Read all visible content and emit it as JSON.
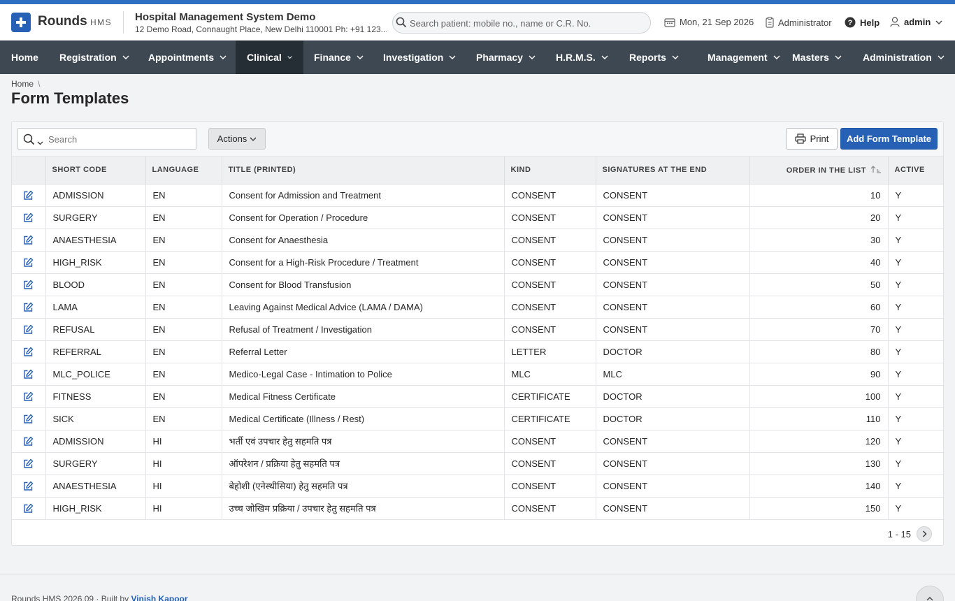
{
  "app": {
    "name": "Rounds",
    "suffix": "HMS",
    "logo_icon": "plus-icon"
  },
  "org": {
    "name": "Hospital Management System Demo",
    "address": "12 Demo Road, Connaught Place, New Delhi 110001 Ph: +91 123..."
  },
  "header": {
    "search_placeholder": "Search patient: mobile no., name or C.R. No.",
    "date": "Mon, 21 Sep 2026",
    "role": "Administrator",
    "help": "Help",
    "user": "admin"
  },
  "nav": {
    "items": [
      "Home",
      "Registration",
      "Appointments",
      "Clinical",
      "Finance",
      "Investigation",
      "Pharmacy",
      "H.R.M.S.",
      "Reports",
      "Management",
      "Masters",
      "Administration"
    ],
    "active": "Clinical"
  },
  "breadcrumb": {
    "home": "Home",
    "separator": "\\"
  },
  "page": {
    "title": "Form Templates"
  },
  "toolbar": {
    "search_placeholder": "Search",
    "actions_label": "Actions",
    "print_label": "Print",
    "add_label": "Add Form Template"
  },
  "table": {
    "columns": [
      "",
      "SHORT CODE",
      "LANGUAGE",
      "TITLE (PRINTED)",
      "KIND",
      "SIGNATURES AT THE END",
      "ORDER IN THE LIST",
      "ACTIVE"
    ],
    "sorted_column": "ORDER IN THE LIST",
    "rows": [
      [
        "ADMISSION",
        "EN",
        "Consent for Admission and Treatment",
        "CONSENT",
        "CONSENT",
        "10",
        "Y"
      ],
      [
        "SURGERY",
        "EN",
        "Consent for Operation / Procedure",
        "CONSENT",
        "CONSENT",
        "20",
        "Y"
      ],
      [
        "ANAESTHESIA",
        "EN",
        "Consent for Anaesthesia",
        "CONSENT",
        "CONSENT",
        "30",
        "Y"
      ],
      [
        "HIGH_RISK",
        "EN",
        "Consent for a High-Risk Procedure / Treatment",
        "CONSENT",
        "CONSENT",
        "40",
        "Y"
      ],
      [
        "BLOOD",
        "EN",
        "Consent for Blood Transfusion",
        "CONSENT",
        "CONSENT",
        "50",
        "Y"
      ],
      [
        "LAMA",
        "EN",
        "Leaving Against Medical Advice (LAMA / DAMA)",
        "CONSENT",
        "CONSENT",
        "60",
        "Y"
      ],
      [
        "REFUSAL",
        "EN",
        "Refusal of Treatment / Investigation",
        "CONSENT",
        "CONSENT",
        "70",
        "Y"
      ],
      [
        "REFERRAL",
        "EN",
        "Referral Letter",
        "LETTER",
        "DOCTOR",
        "80",
        "Y"
      ],
      [
        "MLC_POLICE",
        "EN",
        "Medico-Legal Case - Intimation to Police",
        "MLC",
        "MLC",
        "90",
        "Y"
      ],
      [
        "FITNESS",
        "EN",
        "Medical Fitness Certificate",
        "CERTIFICATE",
        "DOCTOR",
        "100",
        "Y"
      ],
      [
        "SICK",
        "EN",
        "Medical Certificate (Illness / Rest)",
        "CERTIFICATE",
        "DOCTOR",
        "110",
        "Y"
      ],
      [
        "ADMISSION",
        "HI",
        "भर्ती एवं उपचार हेतु सहमति पत्र",
        "CONSENT",
        "CONSENT",
        "120",
        "Y"
      ],
      [
        "SURGERY",
        "HI",
        "ऑपरेशन / प्रक्रिया हेतु सहमति पत्र",
        "CONSENT",
        "CONSENT",
        "130",
        "Y"
      ],
      [
        "ANAESTHESIA",
        "HI",
        "बेहोशी (एनेस्थीसिया) हेतु सहमति पत्र",
        "CONSENT",
        "CONSENT",
        "140",
        "Y"
      ],
      [
        "HIGH_RISK",
        "HI",
        "उच्च जोखिम प्रक्रिया / उपचार हेतु सहमति पत्र",
        "CONSENT",
        "CONSENT",
        "150",
        "Y"
      ]
    ]
  },
  "pagination": {
    "range": "1 - 15"
  },
  "footer": {
    "text": "Rounds HMS 2026.09 · Built by",
    "author": "Vinish Kapoor"
  },
  "colors": {
    "brand": "#2661b6",
    "nav_bg": "#3d4853",
    "nav_active": "#252d35",
    "top_stripe": "#2d6fc0"
  }
}
